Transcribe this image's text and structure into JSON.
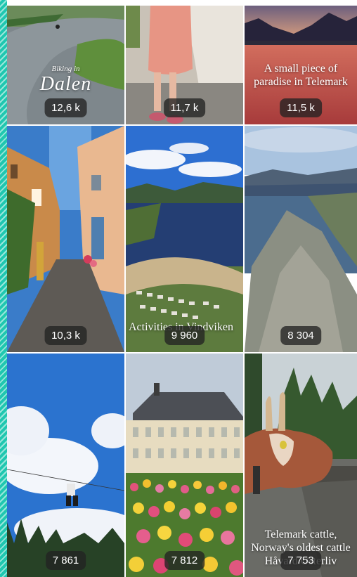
{
  "tiles": [
    {
      "id": "biking-dalen",
      "caption_small": "Biking in",
      "caption_big": "Dalen",
      "count": "12,6 k"
    },
    {
      "id": "child-tent",
      "count": "11,7 k"
    },
    {
      "id": "sunset-lake",
      "caption": "A small piece of paradise in Telemark",
      "count": "11,5 k"
    },
    {
      "id": "street-houses",
      "count": "10,3 k"
    },
    {
      "id": "campsite-aerial",
      "caption": "Activities in Vindviken",
      "count": "9 960"
    },
    {
      "id": "mountain-lake",
      "count": "8 304"
    },
    {
      "id": "zipline-sky",
      "count": "7 861"
    },
    {
      "id": "tulip-building",
      "count": "7 812"
    },
    {
      "id": "telemark-cattle",
      "caption": "Telemark cattle, Norway's oldest cattle Håvard Osterliv",
      "count": "7 753"
    }
  ],
  "colors": {
    "accent": "#1fc7b0",
    "badge": "#232323"
  }
}
